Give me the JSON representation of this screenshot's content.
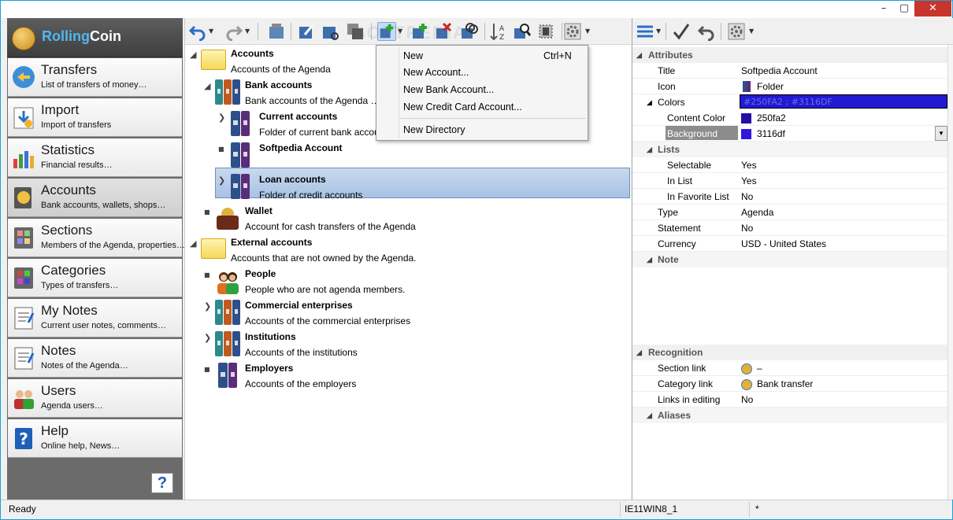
{
  "window": {
    "minimize": "–",
    "maximize": "▢",
    "close": "✕"
  },
  "app": {
    "logo_a": "Rolling",
    "logo_b": "Coin"
  },
  "nav": [
    {
      "title": "Transfers",
      "sub": "List of transfers of money…"
    },
    {
      "title": "Import",
      "sub": "Import of transfers"
    },
    {
      "title": "Statistics",
      "sub": "Financial results…"
    },
    {
      "title": "Accounts",
      "sub": "Bank accounts, wallets, shops…"
    },
    {
      "title": "Sections",
      "sub": "Members of the Agenda, properties…"
    },
    {
      "title": "Categories",
      "sub": "Types of transfers…"
    },
    {
      "title": "My Notes",
      "sub": "Current user notes, comments…"
    },
    {
      "title": "Notes",
      "sub": "Notes of the Agenda…"
    },
    {
      "title": "Users",
      "sub": "Agenda users…"
    },
    {
      "title": "Help",
      "sub": "Online help, News…"
    }
  ],
  "help_button": "?",
  "tree": [
    {
      "title": "Accounts",
      "desc": "Accounts of the Agenda"
    },
    {
      "title": "Bank accounts",
      "desc": "Bank accounts of the Agenda  …"
    },
    {
      "title": "Current accounts",
      "desc": "Folder of current bank accounts"
    },
    {
      "title": "Softpedia Account",
      "desc": ""
    },
    {
      "title": "Loan accounts",
      "desc": "Folder of credit accounts"
    },
    {
      "title": "Wallet",
      "desc": "Account for cash transfers of the Agenda"
    },
    {
      "title": "External accounts",
      "desc": "Accounts that are not owned by the Agenda."
    },
    {
      "title": "People",
      "desc": "People who are not agenda members."
    },
    {
      "title": "Commercial enterprises",
      "desc": "Accounts of the commercial enterprises"
    },
    {
      "title": "Institutions",
      "desc": "Accounts of the institutions"
    },
    {
      "title": "Employers",
      "desc": "Accounts of the employers"
    }
  ],
  "tree_glyphs": {
    "expand": "❯",
    "leaf": "■",
    "collapse": "◢"
  },
  "menu": [
    {
      "label": "New",
      "shortcut": "Ctrl+N"
    },
    {
      "label": "New Account...",
      "shortcut": ""
    },
    {
      "label": "New Bank Account...",
      "shortcut": ""
    },
    {
      "label": "New Credit Card Account...",
      "shortcut": ""
    },
    {
      "label": "New Directory",
      "shortcut": ""
    }
  ],
  "watermark": "SOFTPEDIA",
  "props": {
    "attributes": "Attributes",
    "title_k": "Title",
    "title_v": "Softpedia Account",
    "icon_k": "Icon",
    "icon_v": "Folder",
    "colors_k": "Colors",
    "colors_v": "#250FA2 ; #3116DF",
    "content_color_k": "Content Color",
    "content_color_v": "250fa2",
    "bg_color_k": "Background Color",
    "bg_color_v": "3116df",
    "lists": "Lists",
    "selectable_k": "Selectable",
    "selectable_v": "Yes",
    "in_list_k": "In List",
    "in_list_v": "Yes",
    "in_fav_k": "In Favorite List",
    "in_fav_v": "No",
    "type_k": "Type",
    "type_v": "Agenda",
    "statement_k": "Statement",
    "statement_v": "No",
    "currency_k": "Currency",
    "currency_v": "USD - United States",
    "note": "Note",
    "recognition": "Recognition",
    "section_link_k": "Section link",
    "section_link_v": "–",
    "category_link_k": "Category link",
    "category_link_v": "Bank transfer",
    "links_editing_k": "Links in editing",
    "links_editing_v": "No",
    "aliases": "Aliases"
  },
  "colors": {
    "content": "#250fa2",
    "background": "#3116df",
    "accent": "#2219d2"
  },
  "status": {
    "left": "Ready",
    "mid": "IE11WIN8_1",
    "right": "*"
  }
}
